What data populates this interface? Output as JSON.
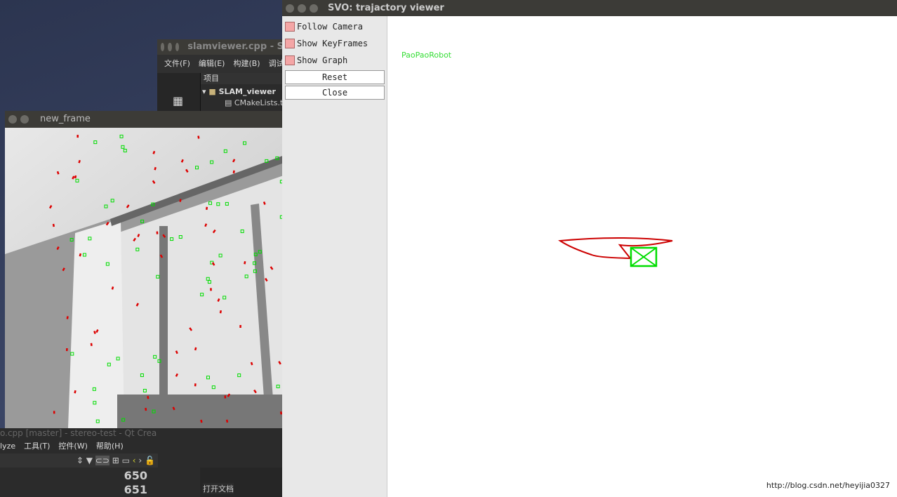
{
  "qt_creator_top": {
    "title": "slamviewer.cpp - S",
    "menu": [
      "文件(F)",
      "编辑(E)",
      "构建(B)",
      "调试("
    ],
    "project_header": "项目",
    "tree": [
      "SLAM_viewer",
      "CMakeLists.t"
    ]
  },
  "qt_creator_bottom": {
    "title": "o.cpp [master] - stereo-test - Qt Crea",
    "menu": [
      "lyze",
      "工具(T)",
      "控件(W)",
      "帮助(H)"
    ],
    "line_numbers": [
      "650",
      "651"
    ],
    "open_docs": "打开文档"
  },
  "new_frame": {
    "title": "new_frame"
  },
  "trajectory_viewer": {
    "title": "SVO: trajactory viewer",
    "checkboxes": [
      {
        "label": "Follow Camera",
        "checked": false
      },
      {
        "label": "Show KeyFrames",
        "checked": false
      },
      {
        "label": "Show Graph",
        "checked": false
      }
    ],
    "reset_label": "Reset",
    "close_label": "Close",
    "overlay_text": "PaoPaoRobot",
    "trajectory_color": "#cc0000",
    "camera_color": "#00dd00"
  },
  "watermark": "http://blog.csdn.net/heyijia0327"
}
